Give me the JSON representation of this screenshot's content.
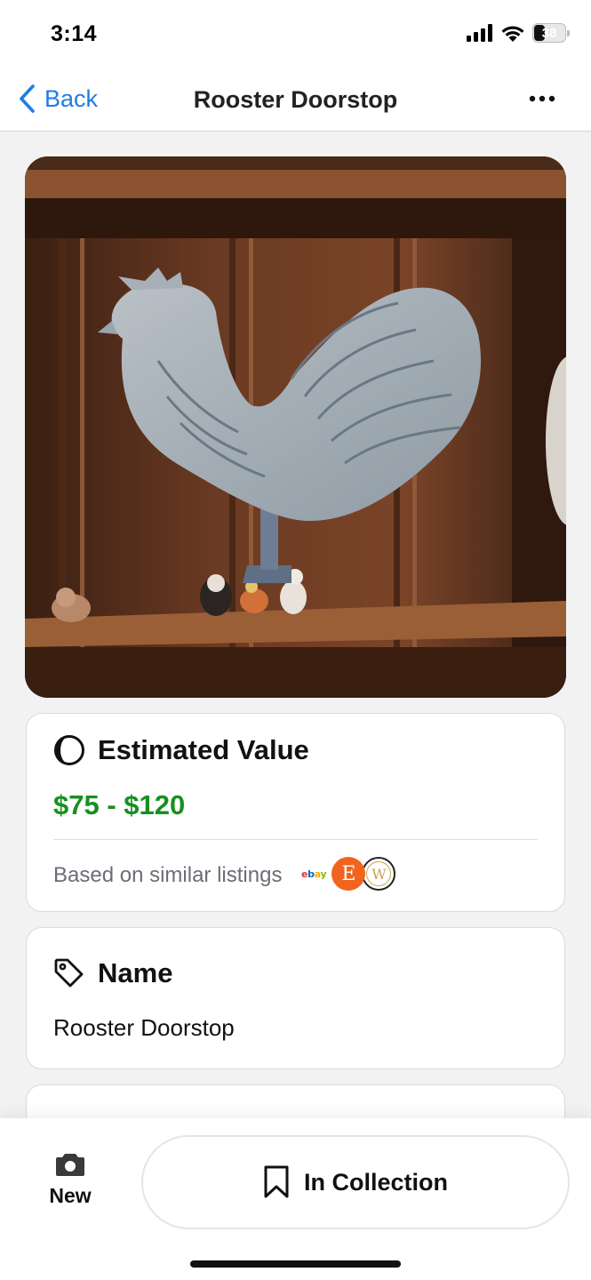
{
  "status_bar": {
    "time": "3:14",
    "battery": "38",
    "battery_level": 0.38
  },
  "nav": {
    "back_label": "Back",
    "title": "Rooster Doorstop",
    "more_icon": "ellipsis-icon"
  },
  "hero": {
    "icon": "photo-rooster"
  },
  "estimated_value": {
    "title": "Estimated Value",
    "range": "$75 - $120",
    "based_on": "Based on similar listings",
    "sources": {
      "ebay": [
        "e",
        "b",
        "a",
        "y"
      ],
      "etsy": "E",
      "worthpoint": "W"
    }
  },
  "name_card": {
    "title": "Name",
    "value": "Rooster Doorstop"
  },
  "bottom_bar": {
    "new_label": "New",
    "collection_label": "In Collection"
  },
  "colors": {
    "accent": "#1e7ce8",
    "value_green": "#17901f",
    "etsy": "#f1641e",
    "muted_text": "#6b6e77"
  }
}
